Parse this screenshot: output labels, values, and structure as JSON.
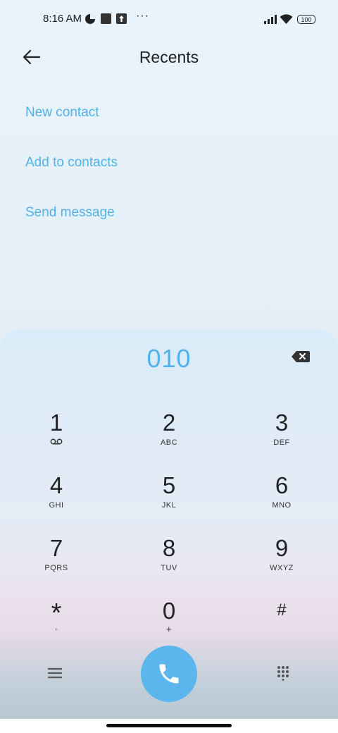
{
  "status_bar": {
    "time": "8:16 AM",
    "more_dots": "···",
    "battery": "100"
  },
  "header": {
    "title": "Recents"
  },
  "actions": {
    "new_contact": "New contact",
    "add_to_contacts": "Add to contacts",
    "send_message": "Send message"
  },
  "dialer": {
    "entered_number": "010",
    "keys": [
      {
        "digit": "1",
        "letters": ""
      },
      {
        "digit": "2",
        "letters": "ABC"
      },
      {
        "digit": "3",
        "letters": "DEF"
      },
      {
        "digit": "4",
        "letters": "GHI"
      },
      {
        "digit": "5",
        "letters": "JKL"
      },
      {
        "digit": "6",
        "letters": "MNO"
      },
      {
        "digit": "7",
        "letters": "PQRS"
      },
      {
        "digit": "8",
        "letters": "TUV"
      },
      {
        "digit": "9",
        "letters": "WXYZ"
      },
      {
        "digit": "*",
        "letters": ","
      },
      {
        "digit": "0",
        "letters": "+"
      },
      {
        "digit": "#",
        "letters": ""
      }
    ]
  },
  "icons": {
    "back": "arrow-left-icon",
    "backspace": "backspace-icon",
    "voicemail": "voicemail-icon",
    "menu": "menu-icon",
    "call": "phone-icon",
    "keypad": "keypad-icon"
  },
  "colors": {
    "accent": "#4fb3ea",
    "call_button": "#5bb6ee"
  }
}
